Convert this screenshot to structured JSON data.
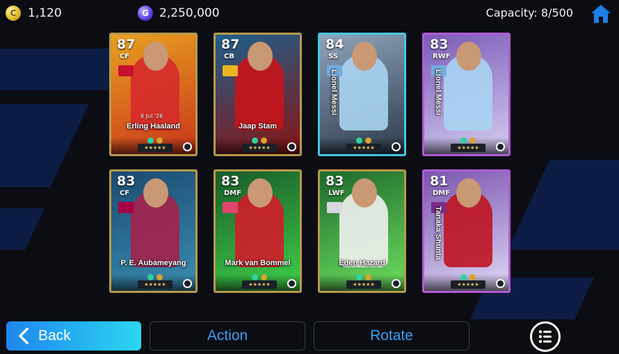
{
  "currency": {
    "gp": {
      "icon": "gp-coin-icon",
      "symbol": "C",
      "amount": "1,120"
    },
    "ecoin": {
      "icon": "ecoin-icon",
      "symbol": "G",
      "amount": "2,250,000"
    }
  },
  "capacity": "Capacity: 8/500",
  "home_icon": "home-icon",
  "cards": [
    {
      "rating": "87",
      "position": "CF",
      "name": "Erling Haaland",
      "date": "6 Jul '26",
      "frame": "gold",
      "bg": [
        "#e8a020",
        "#c8351c"
      ],
      "kit": "#d62a2a",
      "badge": "#c8102e",
      "vertical": false
    },
    {
      "rating": "87",
      "position": "CB",
      "name": "Jaap Stam",
      "frame": "gold",
      "bg": [
        "#1d5f8a",
        "#8a1414"
      ],
      "kit": "#c8141c",
      "badge": "#e8b423",
      "vertical": false
    },
    {
      "rating": "84",
      "position": "SS",
      "name": "Lionel Messi",
      "frame": "silver",
      "bg": [
        "#8fa5bd",
        "#2c3a4c"
      ],
      "kit": "#a9d4f2",
      "badge": "#74acdf",
      "vertical": true
    },
    {
      "rating": "83",
      "position": "RWF",
      "name": "Lionel Messi",
      "frame": "purple",
      "bg": [
        "#7c5ab8",
        "#d4cdf0"
      ],
      "kit": "#a9d4f2",
      "badge": "#74acdf",
      "vertical": true
    },
    {
      "rating": "83",
      "position": "CF",
      "name": "P. E. Aubameyang",
      "frame": "gold",
      "bg": [
        "#1c4a6e",
        "#3b8fb5"
      ],
      "kit": "#a4224c",
      "badge": "#a50044",
      "vertical": false
    },
    {
      "rating": "83",
      "position": "DMF",
      "name": "Mark van Bommel",
      "frame": "gold",
      "bg": [
        "#1a5a2a",
        "#3fd24a"
      ],
      "kit": "#d21c2a",
      "badge": "#e0456e",
      "vertical": false
    },
    {
      "rating": "83",
      "position": "LWF",
      "name": "Eden Hazard",
      "frame": "gold",
      "bg": [
        "#1d6a2c",
        "#6ee060"
      ],
      "kit": "#f1f1f1",
      "badge": "#d8d8e0",
      "vertical": false
    },
    {
      "rating": "81",
      "position": "DMF",
      "name": "Tanaka Shunta",
      "frame": "purple",
      "bg": [
        "#7a55b0",
        "#e0d7f4"
      ],
      "kit": "#c01422",
      "badge": "#7a2d88",
      "vertical": true
    }
  ],
  "buttons": {
    "back": "Back",
    "action": "Action",
    "rotate": "Rotate"
  },
  "icons": {
    "back": "chevron-left-icon",
    "menu": "list-menu-icon"
  }
}
